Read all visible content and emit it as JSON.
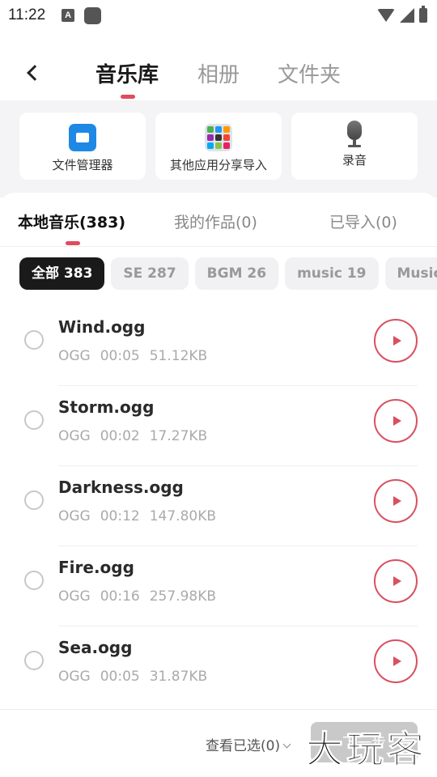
{
  "status_bar": {
    "time": "11:22",
    "a_badge": "A"
  },
  "header": {
    "tabs": [
      {
        "label": "音乐库",
        "active": true
      },
      {
        "label": "相册",
        "active": false
      },
      {
        "label": "文件夹",
        "active": false
      }
    ]
  },
  "sources": [
    {
      "label": "文件管理器",
      "icon": "folder-icon"
    },
    {
      "label": "其他应用分享导入",
      "icon": "apps-icon"
    },
    {
      "label": "录音",
      "icon": "microphone-icon"
    }
  ],
  "sub_tabs": [
    {
      "label": "本地音乐(383)",
      "active": true
    },
    {
      "label": "我的作品(0)",
      "active": false
    },
    {
      "label": "已导入(0)",
      "active": false
    }
  ],
  "chips": [
    {
      "label": "全部 383",
      "active": true
    },
    {
      "label": "SE 287",
      "active": false
    },
    {
      "label": "BGM 26",
      "active": false
    },
    {
      "label": "music 19",
      "active": false
    },
    {
      "label": "Music",
      "active": false
    }
  ],
  "tracks": [
    {
      "name": "Wind.ogg",
      "format": "OGG",
      "duration": "00:05",
      "size": "51.12KB"
    },
    {
      "name": "Storm.ogg",
      "format": "OGG",
      "duration": "00:02",
      "size": "17.27KB"
    },
    {
      "name": "Darkness.ogg",
      "format": "OGG",
      "duration": "00:12",
      "size": "147.80KB"
    },
    {
      "name": "Fire.ogg",
      "format": "OGG",
      "duration": "00:16",
      "size": "257.98KB"
    },
    {
      "name": "Sea.ogg",
      "format": "OGG",
      "duration": "00:05",
      "size": "31.87KB"
    }
  ],
  "bottom": {
    "view_selected": "查看已选(0)",
    "next_label": "下一步"
  },
  "watermark": "大玩客",
  "colors": {
    "accent": "#e14a5f",
    "play": "#d9505f",
    "chip_active": "#1a1a1a"
  }
}
